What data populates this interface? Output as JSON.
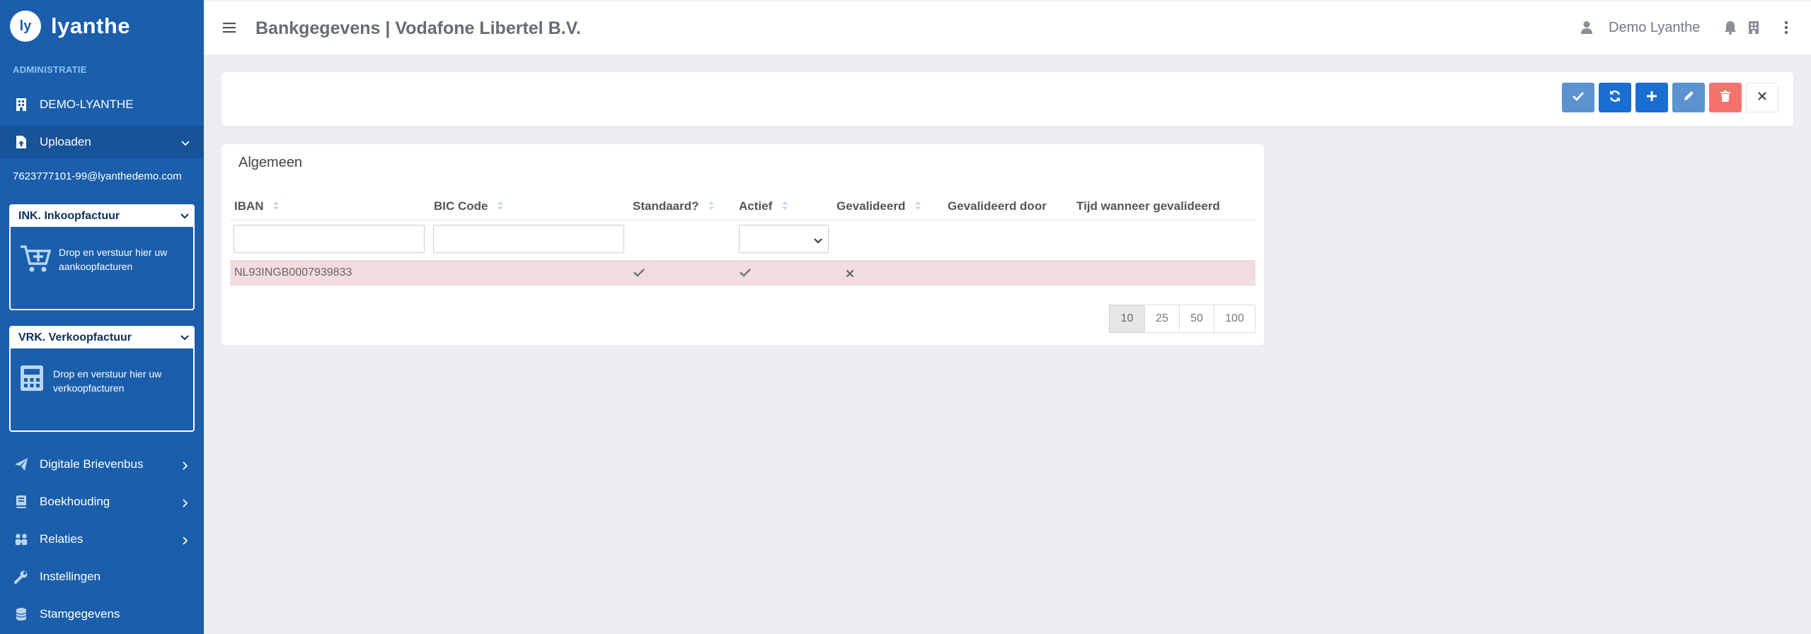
{
  "sidebar": {
    "logo_mark": "ly",
    "logo_text": "lyanthe",
    "section_title": "ADMINISTRATIE",
    "company": "DEMO-LYANTHE",
    "upload_label": "Uploaden",
    "email": "7623777101-99@lyanthedemo.com",
    "purchase_box": {
      "title": "INK. Inkoopfactuur",
      "text_line1": "Drop en verstuur hier uw",
      "text_line2": "aankoopfacturen"
    },
    "sales_box": {
      "title": "VRK. Verkoopfactuur",
      "text_line1": "Drop en verstuur hier uw",
      "text_line2": "verkoopfacturen"
    },
    "items": [
      {
        "label": "Digitale Brievenbus",
        "icon": "paper-plane-icon"
      },
      {
        "label": "Boekhouding",
        "icon": "book-icon"
      },
      {
        "label": "Relaties",
        "icon": "people-icon"
      },
      {
        "label": "Instellingen",
        "icon": "wrench-icon"
      },
      {
        "label": "Stamgegevens",
        "icon": "database-icon"
      }
    ]
  },
  "header": {
    "title": "Bankgegevens | Vodafone Libertel B.V.",
    "user_name": "Demo Lyanthe"
  },
  "toolbar": {
    "buttons": [
      {
        "name": "confirm",
        "icon": "check-icon",
        "color": "#5a93cf"
      },
      {
        "name": "refresh",
        "icon": "refresh-icon",
        "color": "#1a6ed1"
      },
      {
        "name": "add",
        "icon": "plus-icon",
        "color": "#1a6ed1"
      },
      {
        "name": "edit",
        "icon": "pencil-icon",
        "color": "#5a93cf"
      },
      {
        "name": "delete",
        "icon": "trash-icon",
        "color": "#f2736d"
      },
      {
        "name": "close",
        "icon": "close-icon",
        "color": "#ffffff"
      }
    ]
  },
  "card": {
    "title": "Algemeen",
    "columns": [
      "IBAN",
      "BIC Code",
      "Standaard?",
      "Actief",
      "Gevalideerd",
      "Gevalideerd door",
      "Tijd wanneer gevalideerd"
    ],
    "rows": [
      {
        "iban": "NL93INGB0007939833",
        "bic": "",
        "standaard": true,
        "actief": true,
        "gevalideerd": false,
        "gevalideerd_door": "",
        "tijd": ""
      }
    ],
    "page_sizes": [
      "10",
      "25",
      "50",
      "100"
    ],
    "active_page_size": "10"
  },
  "colors": {
    "sidebar": "#1a5eac",
    "row_highlight": "#f3dcdd",
    "primary": "#1a6ed1",
    "danger": "#f2736d"
  }
}
